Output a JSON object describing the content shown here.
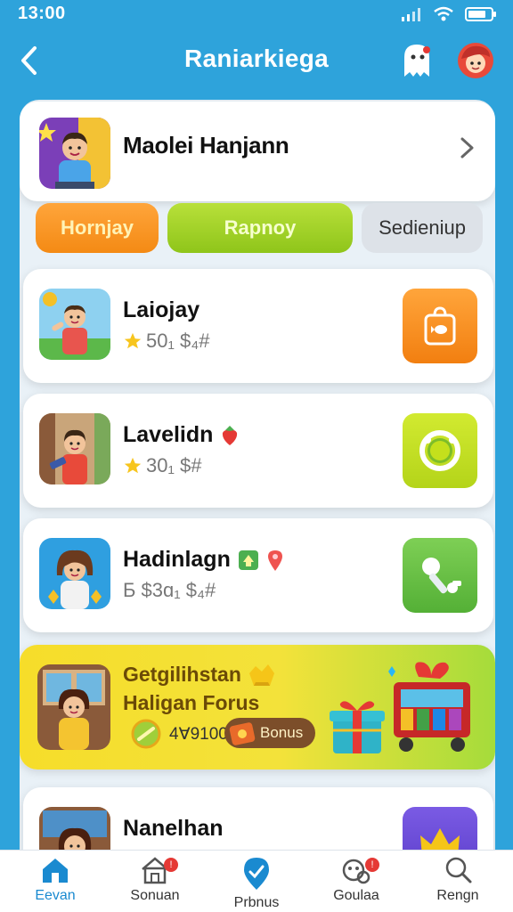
{
  "status_bar": {
    "time": "13:00"
  },
  "header": {
    "title": "Raniarkiega"
  },
  "profile": {
    "name": "Maolei Hanjann"
  },
  "tabs": [
    {
      "label": "Hornjay"
    },
    {
      "label": "Rapnoy"
    },
    {
      "label": "Sedieniup"
    }
  ],
  "items": [
    {
      "title": "Laiojay",
      "sub": "50₁ $₄#"
    },
    {
      "title": "Lavelidn",
      "sub": "30₁ $#"
    },
    {
      "title": "Hadinlagn",
      "sub": "Б $3ɑ₁ $₄#"
    },
    {
      "title": "Nanelhan"
    }
  ],
  "bonus": {
    "title_line1": "Getgilihstan",
    "title_line2": "Haligan Forus",
    "amount": "4Ɐ9100.",
    "button_label": "Bonus"
  },
  "nav": [
    {
      "label": "Eevan"
    },
    {
      "label": "Sonuan"
    },
    {
      "label": "Prbnus"
    },
    {
      "label": "Goulaa"
    },
    {
      "label": "Rengn"
    }
  ],
  "colors": {
    "brand_blue": "#2ea3db",
    "tab_orange": "#f48a14",
    "tab_green": "#8fc51a",
    "tile_orange": "#f7941d",
    "tile_lime": "#c4e01c",
    "tile_green": "#6ac143",
    "tile_purple": "#6b4bd8",
    "bonus_yellow": "#f6dd2a",
    "nav_active": "#1a8ad0"
  },
  "icons": {
    "back": "chevron-left-icon",
    "header_left": "ghost-mascot-icon",
    "header_right": "red-character-icon",
    "item1_action": "shopping-bag-icon",
    "item2_action": "ring-icon",
    "item3_action": "key-icon",
    "item4_action": "crown-icon"
  }
}
